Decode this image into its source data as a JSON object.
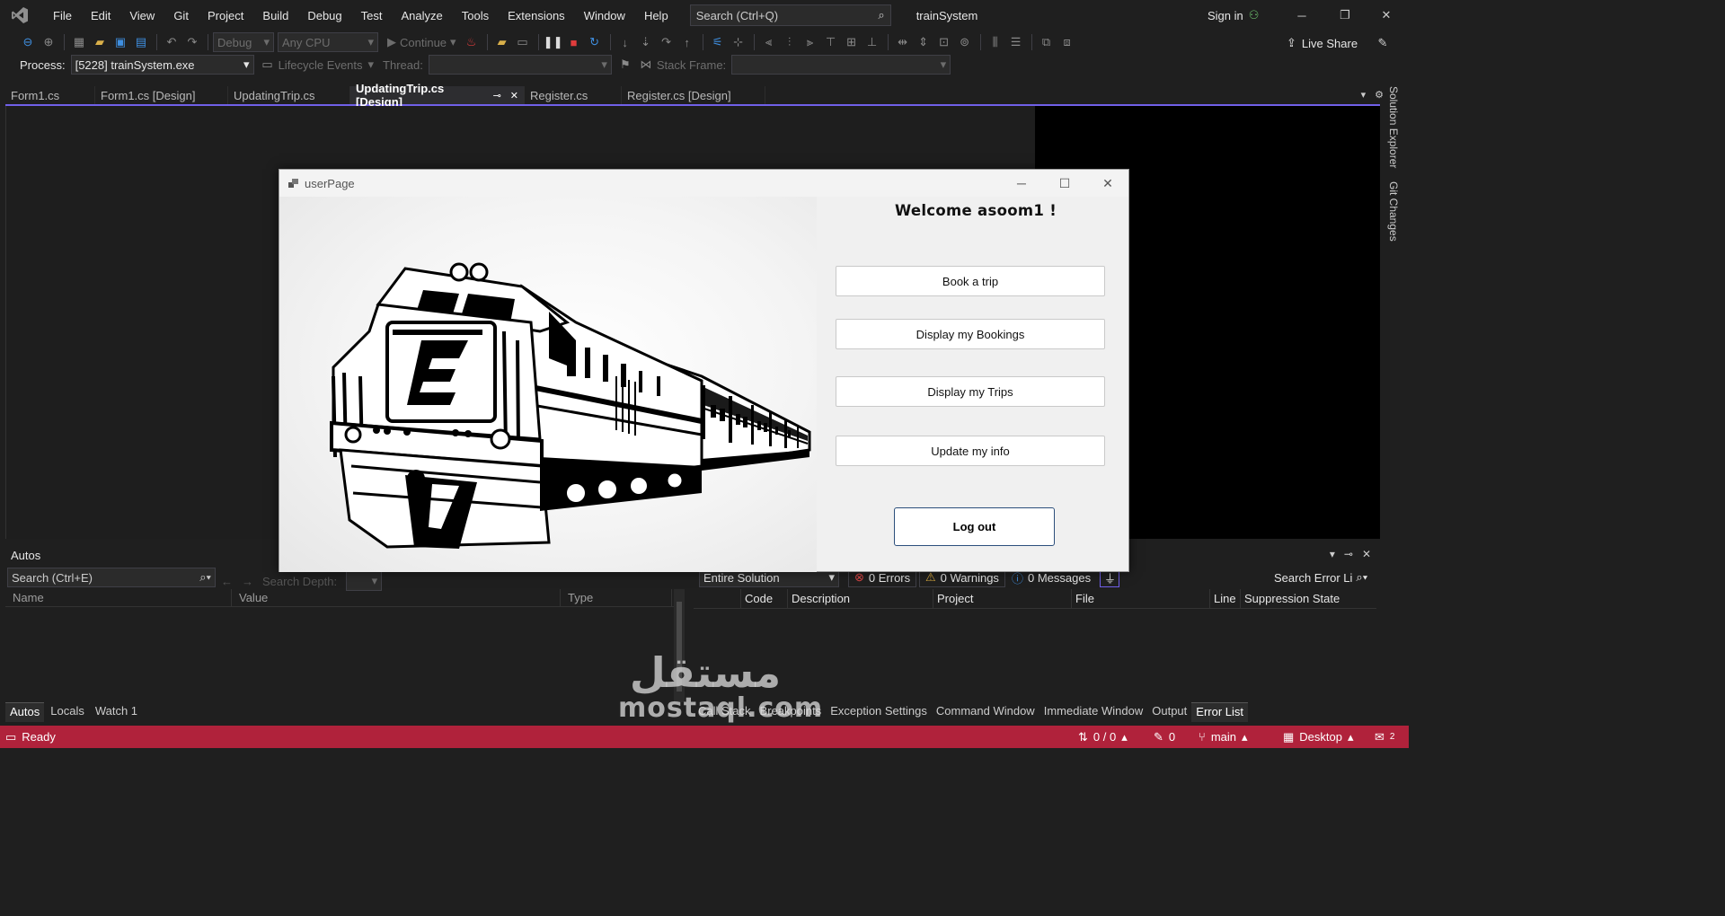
{
  "titlebar": {
    "menu": [
      "File",
      "Edit",
      "View",
      "Git",
      "Project",
      "Build",
      "Debug",
      "Test",
      "Analyze",
      "Tools",
      "Extensions",
      "Window",
      "Help"
    ],
    "search_placeholder": "Search (Ctrl+Q)",
    "solution_name": "trainSystem",
    "sign_in": "Sign in"
  },
  "toolbar": {
    "config": "Debug",
    "platform": "Any CPU",
    "continue": "Continue",
    "live_share": "Live Share"
  },
  "debug_location": {
    "process_label": "Process:",
    "process_value": "[5228] trainSystem.exe",
    "lifecycle": "Lifecycle Events",
    "thread_label": "Thread:",
    "stack_frame_label": "Stack Frame:"
  },
  "doc_tabs": [
    {
      "label": "Form1.cs"
    },
    {
      "label": "Form1.cs [Design]"
    },
    {
      "label": "UpdatingTrip.cs"
    },
    {
      "label": "UpdatingTrip.cs [Design]"
    },
    {
      "label": "Register.cs"
    },
    {
      "label": "Register.cs [Design]"
    }
  ],
  "side_tabs": [
    "Solution Explorer",
    "Git Changes"
  ],
  "form": {
    "title": "userPage",
    "welcome": "Welcome asoom1 !",
    "buttons": [
      "Book a trip",
      "Display my Bookings",
      "Display my Trips",
      "Update my info"
    ],
    "logout": "Log out"
  },
  "autos": {
    "title": "Autos",
    "search_placeholder": "Search (Ctrl+E)",
    "search_depth": "Search Depth:",
    "columns": [
      "Name",
      "Value",
      "Type"
    ]
  },
  "error_list": {
    "scope": "Entire Solution",
    "errors": "0 Errors",
    "warnings": "0 Warnings",
    "messages": "0 Messages",
    "search_placeholder": "Search Error Li",
    "columns": [
      "Code",
      "Description",
      "Project",
      "File",
      "Line",
      "Suppression State"
    ]
  },
  "bottom_tabs_left": [
    "Autos",
    "Locals",
    "Watch 1"
  ],
  "bottom_tabs_right": [
    "Call Stack",
    "Breakpoints",
    "Exception Settings",
    "Command Window",
    "Immediate Window",
    "Output",
    "Error List"
  ],
  "statusbar": {
    "state": "Ready",
    "line_col": "0 / 0",
    "edits": "0",
    "branch": "main",
    "target": "Desktop",
    "notifications": "2"
  },
  "watermark": {
    "arabic": "مستقل",
    "latin": "mostaql.com"
  },
  "colors": {
    "status_bar": "#b0223b",
    "tab_accent": "#7160e8",
    "logout_border": "#2c4f7c"
  }
}
